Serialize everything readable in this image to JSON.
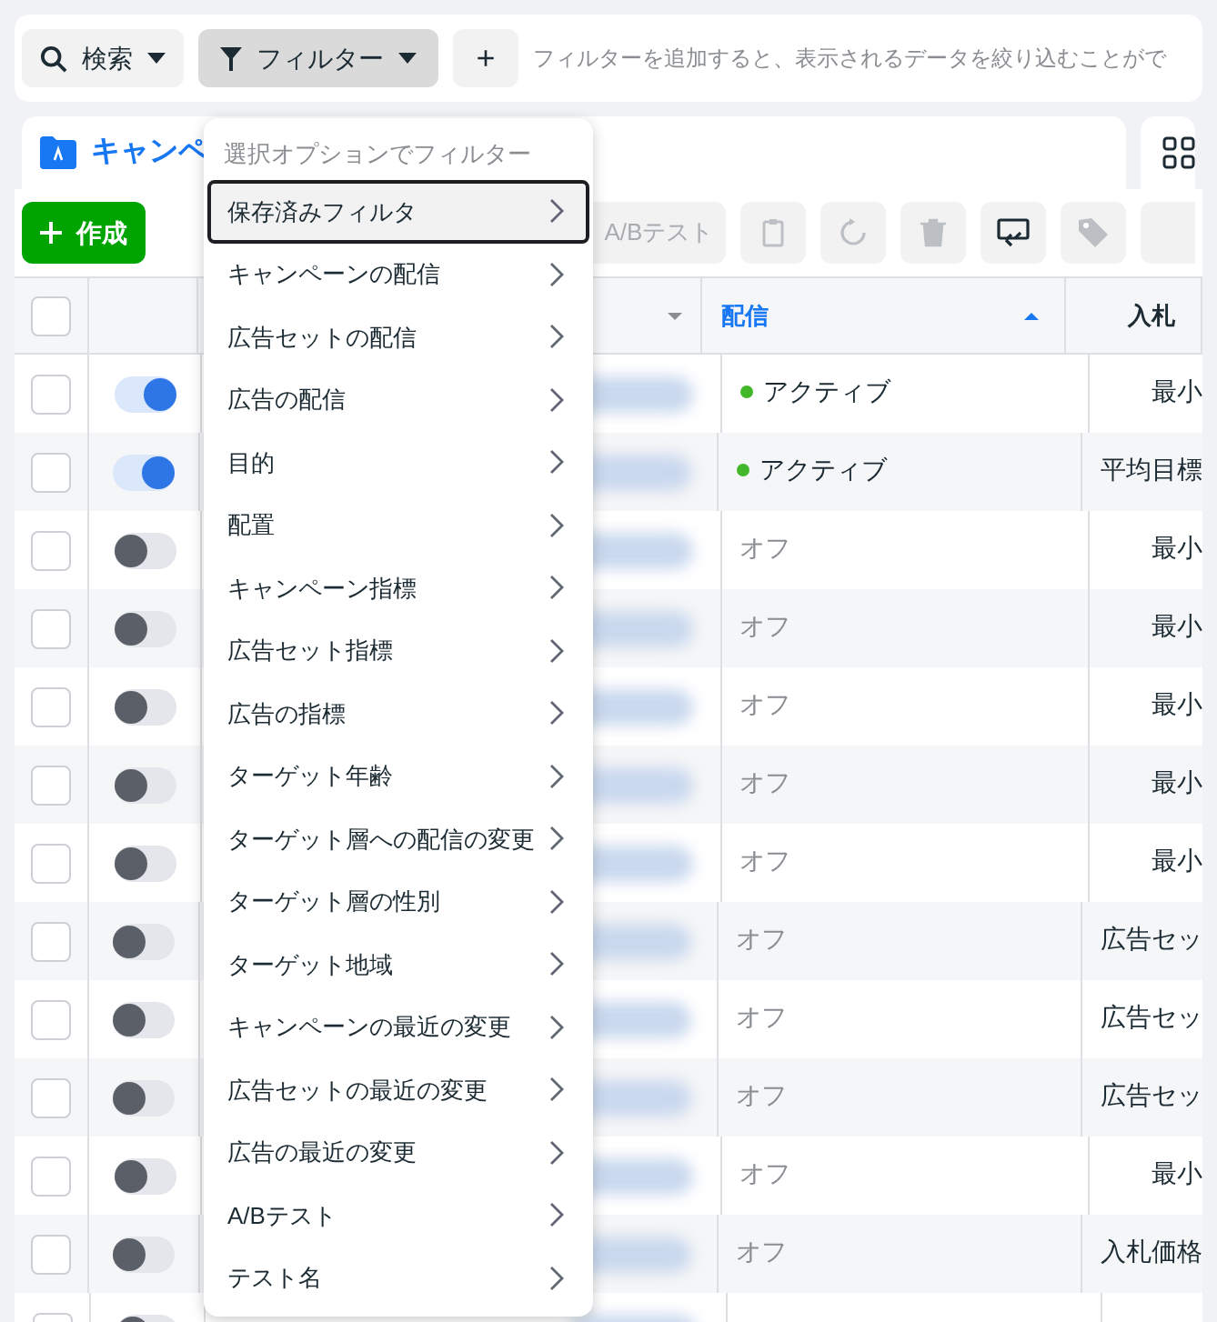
{
  "search_bar": {
    "search_button": "検索",
    "filter_button": {
      "label": "フィルター",
      "selected": true
    },
    "add_button": "+",
    "placeholder": "フィルターを追加すると、表示されるデータを絞り込むことがで"
  },
  "tabs": [
    {
      "label": "キャンペ",
      "selected": true
    }
  ],
  "toolbar": {
    "create_button": "作成",
    "ab_test_button": "A/Bテスト"
  },
  "table": {
    "select_all_checked": false,
    "columns": [
      {
        "label": "配信",
        "sorted": true
      },
      {
        "label": "入札",
        "sorted": false
      }
    ],
    "rows": [
      {
        "checked": false,
        "on": true,
        "delivery": "アクティブ",
        "bid": "最小"
      },
      {
        "checked": false,
        "on": true,
        "delivery": "アクティブ",
        "bid": "平均目標"
      },
      {
        "checked": false,
        "on": false,
        "delivery": "オフ",
        "bid": "最小"
      },
      {
        "checked": false,
        "on": false,
        "delivery": "オフ",
        "bid": "最小"
      },
      {
        "checked": false,
        "on": false,
        "delivery": "オフ",
        "bid": "最小"
      },
      {
        "checked": false,
        "on": false,
        "delivery": "オフ",
        "bid": "最小"
      },
      {
        "checked": false,
        "on": false,
        "delivery": "オフ",
        "bid": "最小"
      },
      {
        "checked": false,
        "on": false,
        "delivery": "オフ",
        "bid": "広告セッ"
      },
      {
        "checked": false,
        "on": false,
        "delivery": "オフ",
        "bid": "広告セッ"
      },
      {
        "checked": false,
        "on": false,
        "delivery": "オフ",
        "bid": "広告セッ"
      },
      {
        "checked": false,
        "on": false,
        "delivery": "オフ",
        "bid": "最小"
      },
      {
        "checked": false,
        "on": false,
        "delivery": "オフ",
        "bid": "入札価格"
      },
      {
        "checked": false,
        "on": false
      }
    ]
  },
  "filter_menu": {
    "heading": "選択オプションでフィルター",
    "items": [
      {
        "label": "保存済みフィルタ",
        "selected": true
      },
      {
        "label": "キャンペーンの配信",
        "selected": false
      },
      {
        "label": "広告セットの配信",
        "selected": false
      },
      {
        "label": "広告の配信",
        "selected": false
      },
      {
        "label": "目的",
        "selected": false
      },
      {
        "label": "配置",
        "selected": false
      },
      {
        "label": "キャンペーン指標",
        "selected": false
      },
      {
        "label": "広告セット指標",
        "selected": false
      },
      {
        "label": "広告の指標",
        "selected": false
      },
      {
        "label": "ターゲット年齢",
        "selected": false
      },
      {
        "label": "ターゲット層への配信の変更",
        "selected": false
      },
      {
        "label": "ターゲット層の性別",
        "selected": false
      },
      {
        "label": "ターゲット地域",
        "selected": false
      },
      {
        "label": "キャンペーンの最近の変更",
        "selected": false
      },
      {
        "label": "広告セットの最近の変更",
        "selected": false
      },
      {
        "label": "広告の最近の変更",
        "selected": false
      },
      {
        "label": "A/Bテスト",
        "selected": false
      },
      {
        "label": "テスト名",
        "selected": false
      }
    ]
  }
}
